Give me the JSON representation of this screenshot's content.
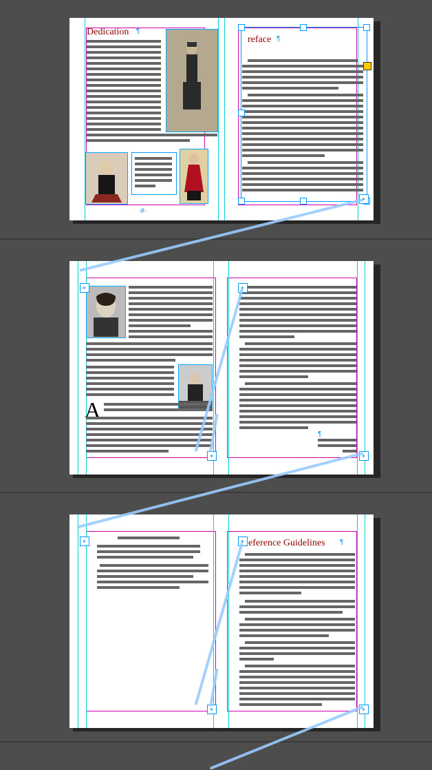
{
  "app": "InDesign",
  "headings": {
    "dedication": "Dedication",
    "preface": "reface",
    "ref_guidelines": "eference Guidelines"
  },
  "colors": {
    "heading": "#8b0000",
    "guides_margin": "#d000b0",
    "guides_ruler": "#00d0d0",
    "selection": "#0099ff",
    "thread": "#a0c8ff",
    "overflow": "#ffcc00",
    "pasteboard": "#4d4d4d",
    "block": "#666666"
  },
  "images": {
    "man_portrait": "man-portrait-bw",
    "girl_black_dress": "girl-black-dress",
    "girl_red_dress": "girl-red-dress",
    "woman_bw": "woman-portrait-bw",
    "woman_table": "woman-at-table-bw"
  },
  "ports": {
    "in": "in-port",
    "out": "out-port",
    "overflow": "overflow"
  }
}
